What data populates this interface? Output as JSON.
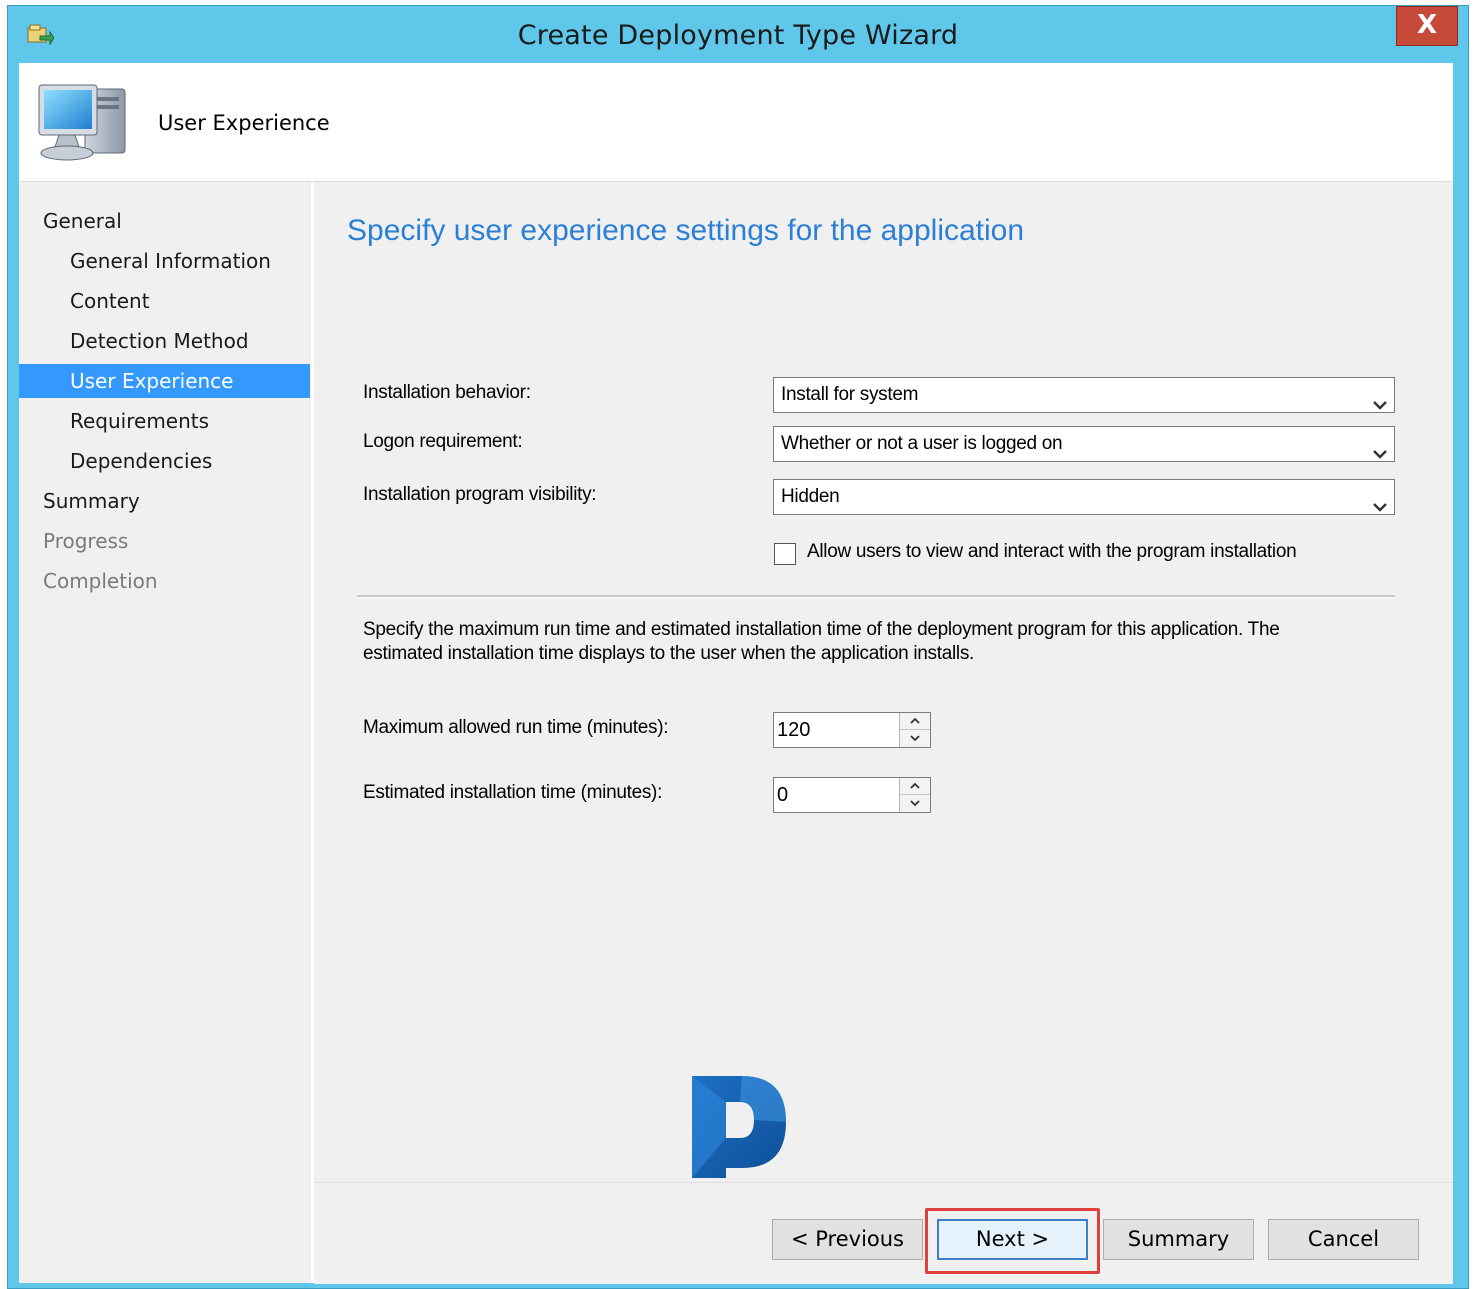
{
  "window": {
    "title": "Create Deployment Type Wizard",
    "close_label": "X",
    "accent_color": "#5fc8ea"
  },
  "header": {
    "title": "User Experience",
    "icon": "computer-icon"
  },
  "nav": {
    "items": [
      {
        "label": "General",
        "level": 0,
        "state": "normal"
      },
      {
        "label": "General Information",
        "level": 1,
        "state": "normal"
      },
      {
        "label": "Content",
        "level": 1,
        "state": "normal"
      },
      {
        "label": "Detection Method",
        "level": 1,
        "state": "normal"
      },
      {
        "label": "User Experience",
        "level": 1,
        "state": "active"
      },
      {
        "label": "Requirements",
        "level": 1,
        "state": "normal"
      },
      {
        "label": "Dependencies",
        "level": 1,
        "state": "normal"
      },
      {
        "label": "Summary",
        "level": 0,
        "state": "normal"
      },
      {
        "label": "Progress",
        "level": 0,
        "state": "disabled"
      },
      {
        "label": "Completion",
        "level": 0,
        "state": "disabled"
      }
    ],
    "active_color": "#3399ff"
  },
  "content": {
    "heading": "Specify user experience settings for the application",
    "heading_color": "#2b7fd6",
    "installation_behavior": {
      "label": "Installation behavior:",
      "value": "Install for system"
    },
    "logon_requirement": {
      "label": "Logon requirement:",
      "value": "Whether or not a user is logged on"
    },
    "program_visibility": {
      "label": "Installation program visibility:",
      "value": "Hidden"
    },
    "allow_interact": {
      "label": "Allow users to view and interact with the program installation",
      "checked": false
    },
    "description": "Specify the maximum run time and estimated installation time of the deployment program for this application. The estimated installation time displays to the user when the application installs.",
    "max_run_time": {
      "label": "Maximum allowed run time (minutes):",
      "value": "120"
    },
    "estimated_time": {
      "label": "Estimated installation time (minutes):",
      "value": "0"
    },
    "watermark_icon": "p-logo-icon"
  },
  "footer": {
    "previous_label": "< Previous",
    "next_label": "Next >",
    "summary_label": "Summary",
    "cancel_label": "Cancel",
    "highlight_color": "#e0403c"
  }
}
